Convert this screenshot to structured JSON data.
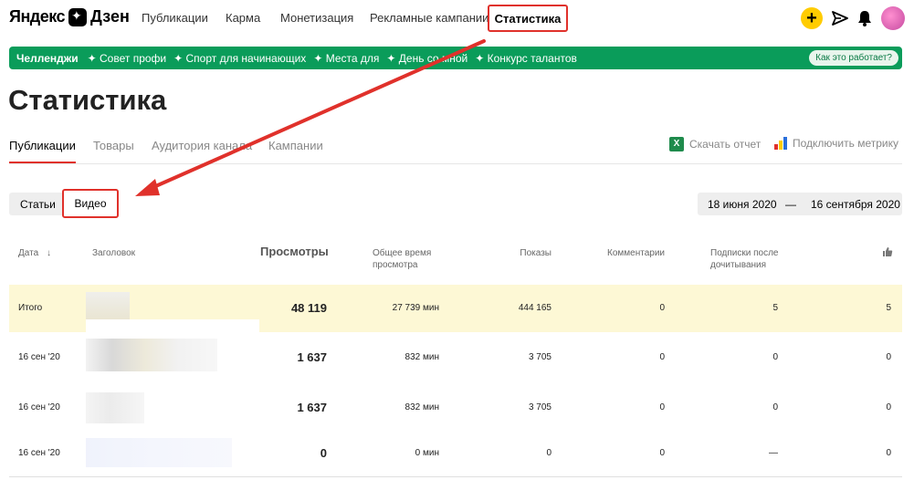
{
  "header": {
    "logo_ya": "Яндекс",
    "logo_dzen": "Дзен",
    "nav": [
      "Публикации",
      "Карма",
      "Монетизация",
      "Рекламные кампании"
    ],
    "nav_active": "Статистика",
    "plus_label": "+"
  },
  "challenges": {
    "title": "Челленджи",
    "items": [
      "Совет профи",
      "Спорт для начинающих",
      "Места для",
      "День со мной",
      "Конкурс талантов"
    ],
    "how_button": "Как это работает?"
  },
  "page_title": "Статистика",
  "tabs": [
    "Публикации",
    "Товары",
    "Аудитория канала",
    "Кампании"
  ],
  "tools": {
    "download": "Скачать отчет",
    "metrika": "Подключить метрику",
    "xls_glyph": "X"
  },
  "content_type": {
    "articles": "Статьи",
    "video": "Видео"
  },
  "date_range": {
    "from": "18 июня 2020",
    "separator": "—",
    "to": "16 сентября 2020"
  },
  "table": {
    "columns": {
      "date": "Дата",
      "title": "Заголовок",
      "views": "Просмотры",
      "watch_time": "Общее время просмотра",
      "impressions": "Показы",
      "comments": "Комментарии",
      "subs": "Подписки после дочитывания",
      "likes_icon": "thumbs-up-icon"
    },
    "rows": [
      {
        "date": "Итого",
        "views": "48 119",
        "time": "27 739 мин",
        "shows": "444 165",
        "comments": "0",
        "subs": "5",
        "likes": "5"
      },
      {
        "date": "16 сен '20",
        "views": "1 637",
        "time": "832 мин",
        "shows": "3 705",
        "comments": "0",
        "subs": "0",
        "likes": "0"
      },
      {
        "date": "16 сен '20",
        "views": "1 637",
        "time": "832 мин",
        "shows": "3 705",
        "comments": "0",
        "subs": "0",
        "likes": "0"
      },
      {
        "date": "16 сен '20",
        "views": "0",
        "time": "0 мин",
        "shows": "0",
        "comments": "0",
        "subs": "—",
        "likes": "0"
      }
    ]
  },
  "colors": {
    "accent_red": "#e0312b",
    "green_bar": "#0a9c5a",
    "total_row": "#fdf8d5",
    "plus_yellow": "#ffcc00"
  }
}
